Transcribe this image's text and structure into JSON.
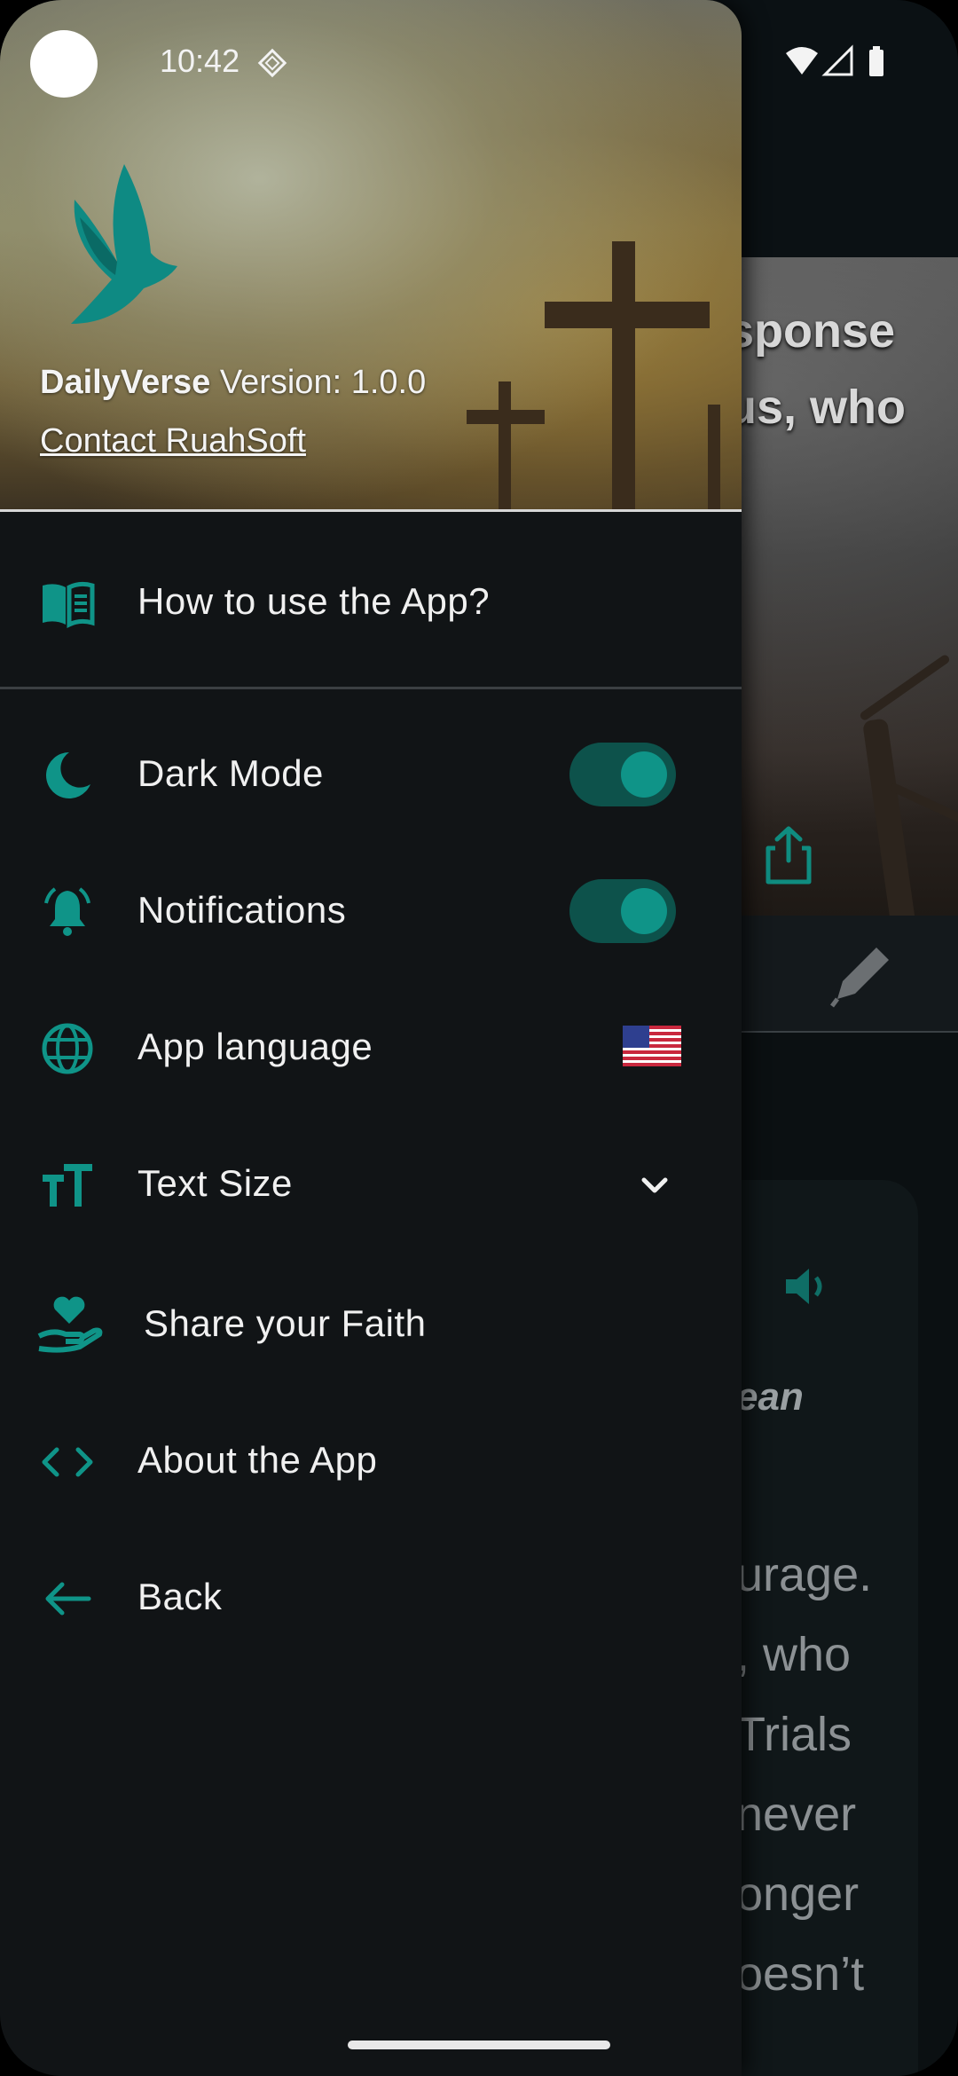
{
  "status_bar": {
    "time": "10:42"
  },
  "background_app": {
    "hero_lines": [
      "sponse",
      "us, who"
    ],
    "italic_text": "ean",
    "body_lines": [
      "urage.",
      ", who",
      "Trials",
      "never",
      "onger",
      "oesn’t"
    ]
  },
  "drawer": {
    "app_name": "DailyVerse",
    "version_text": "Version: 1.0.0",
    "contact_link": "Contact RuahSoft",
    "items": [
      {
        "label": "How to use the App?",
        "icon": "book-icon"
      },
      {
        "label": "Dark Mode",
        "icon": "moon-icon",
        "toggle_on": true
      },
      {
        "label": "Notifications",
        "icon": "bell-icon",
        "toggle_on": true
      },
      {
        "label": "App language",
        "icon": "globe-icon",
        "value_icon": "us-flag-icon"
      },
      {
        "label": "Text Size",
        "icon": "text-size-icon",
        "value_icon": "chevron-down-icon"
      },
      {
        "label": "Share your Faith",
        "icon": "heart-hand-icon"
      },
      {
        "label": "About the App",
        "icon": "code-icon"
      },
      {
        "label": "Back",
        "icon": "arrow-left-icon"
      }
    ]
  },
  "colors": {
    "accent": "#0f9488",
    "toggle_track": "#0d524b",
    "drawer_bg": "#111416"
  }
}
